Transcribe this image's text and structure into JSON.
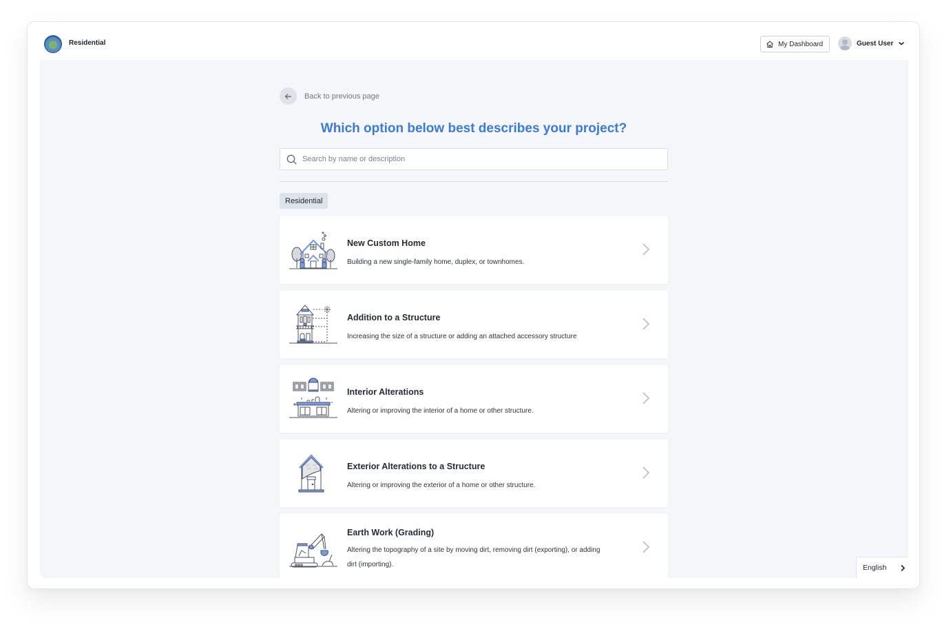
{
  "header": {
    "app_title": "Residential",
    "logo": "county-seal-logo",
    "dashboard_button": {
      "label": "My Dashboard",
      "icon": "home-icon"
    },
    "user_menu": {
      "label": "Guest User",
      "icon": "chevron-down-icon"
    }
  },
  "main": {
    "back_link": {
      "label": "Back to previous page",
      "icon": "arrow-left-icon"
    },
    "question": "Which option below best describes your project?",
    "search": {
      "placeholder": "Search by name or description",
      "value": "",
      "icon": "search-icon"
    },
    "category_chip": "Residential",
    "options": [
      {
        "title": "New Custom Home",
        "description": "Building a new single-family home, duplex, or townhomes.",
        "icon": "house-illustration"
      },
      {
        "title": "Addition to a Structure",
        "description": "Increasing the size of a structure or adding an attached accessory structure",
        "icon": "addition-illustration"
      },
      {
        "title": "Interior Alterations",
        "description": "Altering or improving the interior of a home or other structure.",
        "icon": "interior-illustration"
      },
      {
        "title": "Exterior Alterations to a Structure",
        "description": "Altering or improving the exterior of a home or other structure.",
        "icon": "exterior-illustration"
      },
      {
        "title": "Earth Work (Grading)",
        "description": "Altering the topography of a site by moving dirt, removing dirt (exporting), or adding dirt (importing).",
        "icon": "excavator-illustration"
      }
    ]
  },
  "language_selector": {
    "label": "English",
    "icon": "chevron-right-icon"
  },
  "colors": {
    "accent": "#3b7ad6",
    "illustration_blue": "#7a9be6",
    "page_bg": "#f4f6f9"
  }
}
